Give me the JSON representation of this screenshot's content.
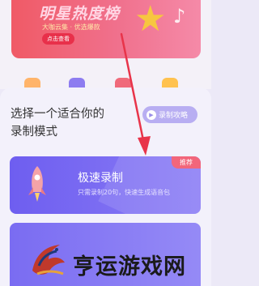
{
  "banner": {
    "title": "明星热度榜",
    "subtitle": "大咖云集 · 优选爆款",
    "button_label": "点击查看"
  },
  "sheet": {
    "heading_line1": "选择一个适合你的",
    "heading_line2": "录制模式",
    "tutorial_label": "录制攻略"
  },
  "mode_card": {
    "badge": "推荐",
    "title": "极速录制",
    "description": "只需录制20句，快速生成语音包"
  },
  "watermark": {
    "text": "亨运游戏网"
  },
  "colors": {
    "banner_red": "#f05a66",
    "card_purple": "#6e5ef0",
    "badge_pink": "#f2667b",
    "arrow_red": "#e8344a"
  }
}
